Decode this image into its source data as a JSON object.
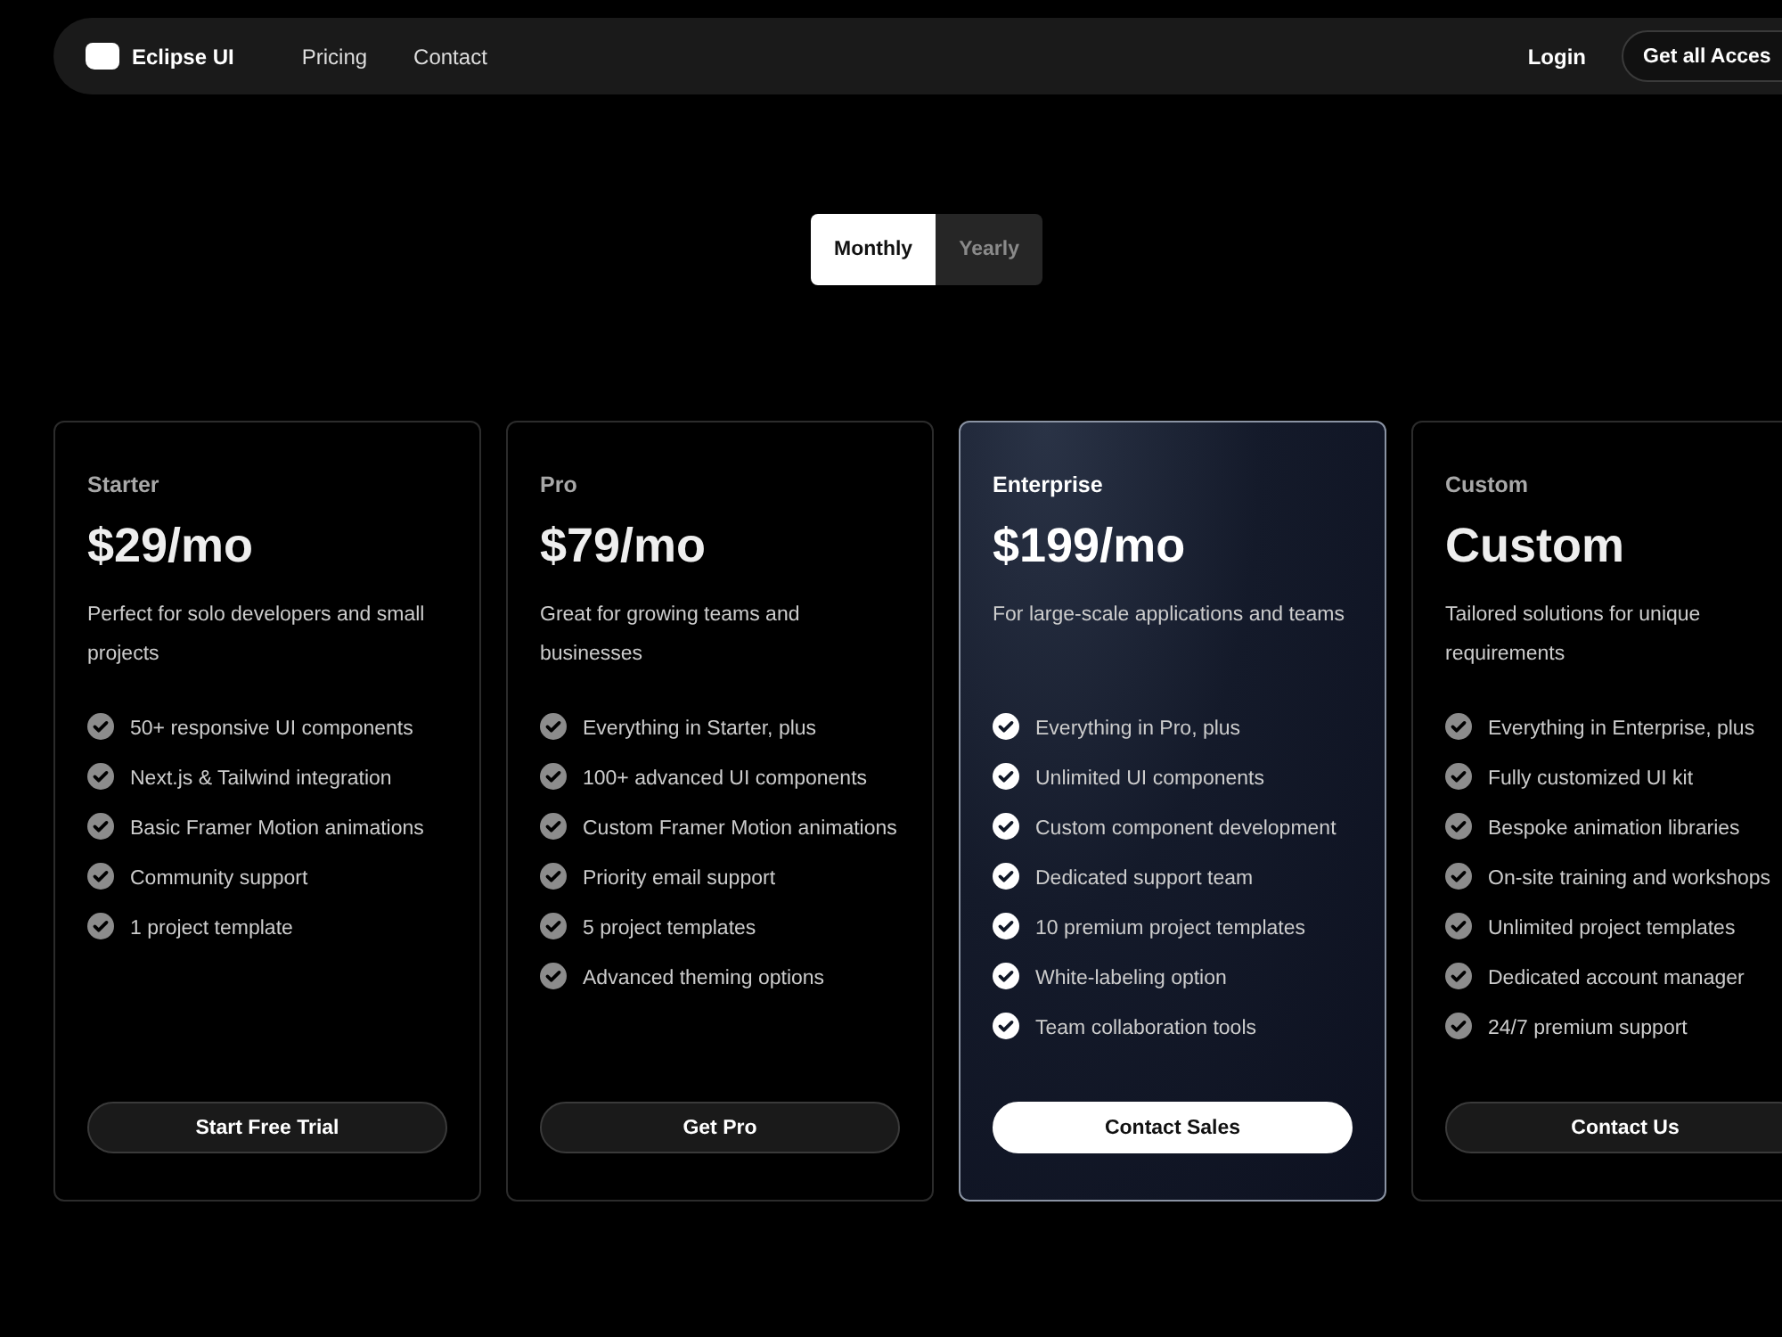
{
  "navbar": {
    "brand": "Eclipse UI",
    "links": [
      "Pricing",
      "Contact"
    ],
    "login": "Login",
    "cta": "Get all Acces"
  },
  "billing_toggle": [
    {
      "label": "Monthly",
      "selected": true
    },
    {
      "label": "Yearly",
      "selected": false
    }
  ],
  "plans": [
    {
      "name": "Starter",
      "price": "$29/mo",
      "description": "Perfect for solo developers and small projects",
      "highlighted": false,
      "features": [
        "50+ responsive UI components",
        "Next.js & Tailwind integration",
        "Basic Framer Motion animations",
        "Community support",
        "1 project template"
      ],
      "button": "Start Free Trial"
    },
    {
      "name": "Pro",
      "price": "$79/mo",
      "description": "Great for growing teams and businesses",
      "highlighted": false,
      "features": [
        "Everything in Starter, plus",
        "100+ advanced UI components",
        "Custom Framer Motion animations",
        "Priority email support",
        "5 project templates",
        "Advanced theming options"
      ],
      "button": "Get Pro"
    },
    {
      "name": "Enterprise",
      "price": "$199/mo",
      "description": "For large-scale applications and teams",
      "highlighted": true,
      "features": [
        "Everything in Pro, plus",
        "Unlimited UI components",
        "Custom component development",
        "Dedicated support team",
        "10 premium project templates",
        "White-labeling option",
        "Team collaboration tools"
      ],
      "button": "Contact Sales"
    },
    {
      "name": "Custom",
      "price": "Custom",
      "description": "Tailored solutions for unique requirements",
      "highlighted": false,
      "features": [
        "Everything in Enterprise, plus",
        "Fully customized UI kit",
        "Bespoke animation libraries",
        "On-site training and workshops",
        "Unlimited project templates",
        "Dedicated account manager",
        "24/7 premium support"
      ],
      "button": "Contact Us"
    }
  ]
}
